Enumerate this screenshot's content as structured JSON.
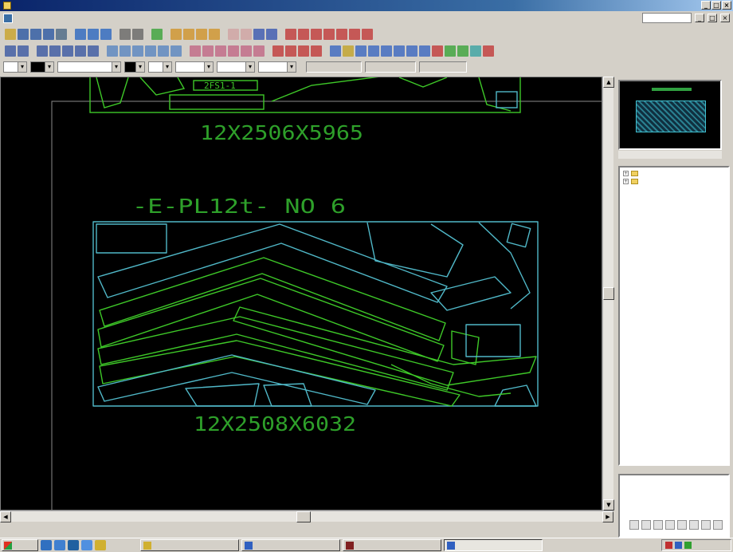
{
  "window": {
    "title": "",
    "buttons": [
      "_",
      "□",
      "×"
    ]
  },
  "menu": {
    "items": [
      "",
      "",
      "",
      "",
      "",
      "",
      "",
      "",
      "",
      ""
    ],
    "help_field": ""
  },
  "toolbar_colors": {
    "row1": [
      "#c8a020",
      "#2050a0",
      "#2050a0",
      "#2050a0",
      "#406080",
      "sep",
      "#2060c0",
      "#2060c0",
      "#2060c0",
      "sep",
      "#606060",
      "#606060",
      "sep",
      "#30a030",
      "sep",
      "#d09020",
      "#d09020",
      "#d09020",
      "#d09020",
      "sep",
      "#d0a0a0",
      "#d0a0a0",
      "#3050b0",
      "#3050b0",
      "sep",
      "#c03030",
      "#c03030",
      "#c03030",
      "#c03030",
      "#c03030",
      "#c03030",
      "#c03030"
    ],
    "row2": [
      "#3050a0",
      "#3050a0",
      "sep",
      "#3050a0",
      "#3050a0",
      "#3050a0",
      "#3050a0",
      "#3050a0",
      "sep",
      "#5080c0",
      "#5080c0",
      "#5080c0",
      "#5080c0",
      "#5080c0",
      "#5080c0",
      "sep",
      "#c06080",
      "#c06080",
      "#c06080",
      "#c06080",
      "#c06080",
      "#c06080",
      "sep",
      "#c03030",
      "#c03030",
      "#c03030",
      "#c03030",
      "sep",
      "#3060c0",
      "#c0a020",
      "#3060c0",
      "#3060c0",
      "#3060c0",
      "#3060c0",
      "#3060c0",
      "#3060c0",
      "#c03030",
      "#30a030",
      "#30a030",
      "#30a0a0",
      "#c03030"
    ]
  },
  "combos": [
    "",
    "",
    "",
    "",
    "",
    "",
    "",
    ""
  ],
  "coords": [
    "",
    "",
    ""
  ],
  "drawing": {
    "top_dim_label": "12X2506X5965",
    "part_label": "-E-PL12t-  NO 6",
    "bottom_dim_label": "12X2508X6032",
    "top_part_tag_1": "2FS1-1",
    "top_part_tag_2": "",
    "colors": {
      "background": "#000000",
      "green_parts": "#3ec828",
      "cyan_outline": "#50b8c8",
      "label_green": "#2ea02a",
      "frame_grey": "#8a8a8a"
    }
  },
  "tree": {
    "items": [
      "",
      ""
    ]
  },
  "taskbar": {
    "start_label": "",
    "tasks": [
      "",
      "",
      "",
      ""
    ],
    "clock": ""
  }
}
